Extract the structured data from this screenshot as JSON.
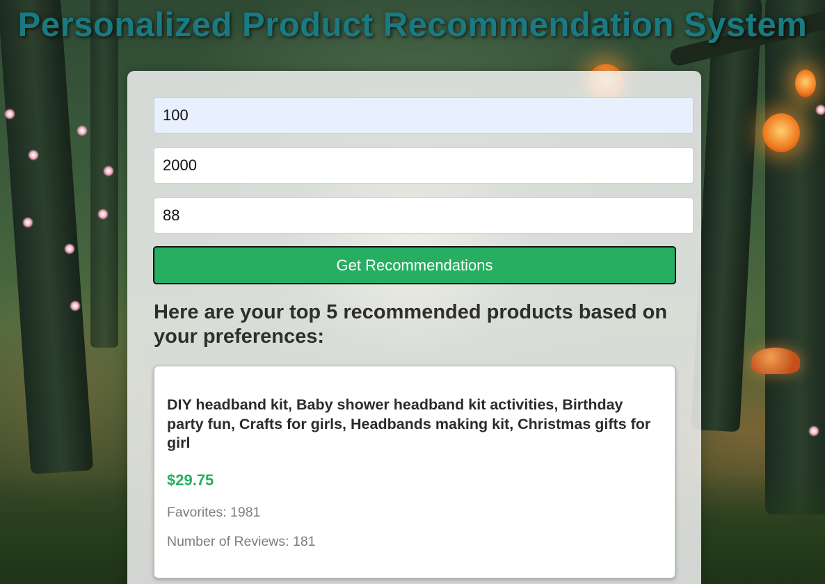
{
  "header": {
    "title": "Personalized Product Recommendation System"
  },
  "form": {
    "field_1_value": "100",
    "field_2_value": "2000",
    "field_3_value": "88",
    "submit_label": "Get Recommendations"
  },
  "results": {
    "heading": "Here are your top 5 recommended products based on your preferences:",
    "products": [
      {
        "name": "DIY headband kit, Baby shower headband kit activities, Birthday party fun, Crafts for girls, Headbands making kit, Christmas gifts for girl",
        "price": "$29.75",
        "favorites_text": "Favorites: 1981",
        "reviews_text": "Number of Reviews: 181"
      }
    ]
  },
  "colors": {
    "title": "#1a7a82",
    "button": "#27ae60",
    "price": "#27ae60",
    "autofill_field": "#e8f0fe"
  }
}
